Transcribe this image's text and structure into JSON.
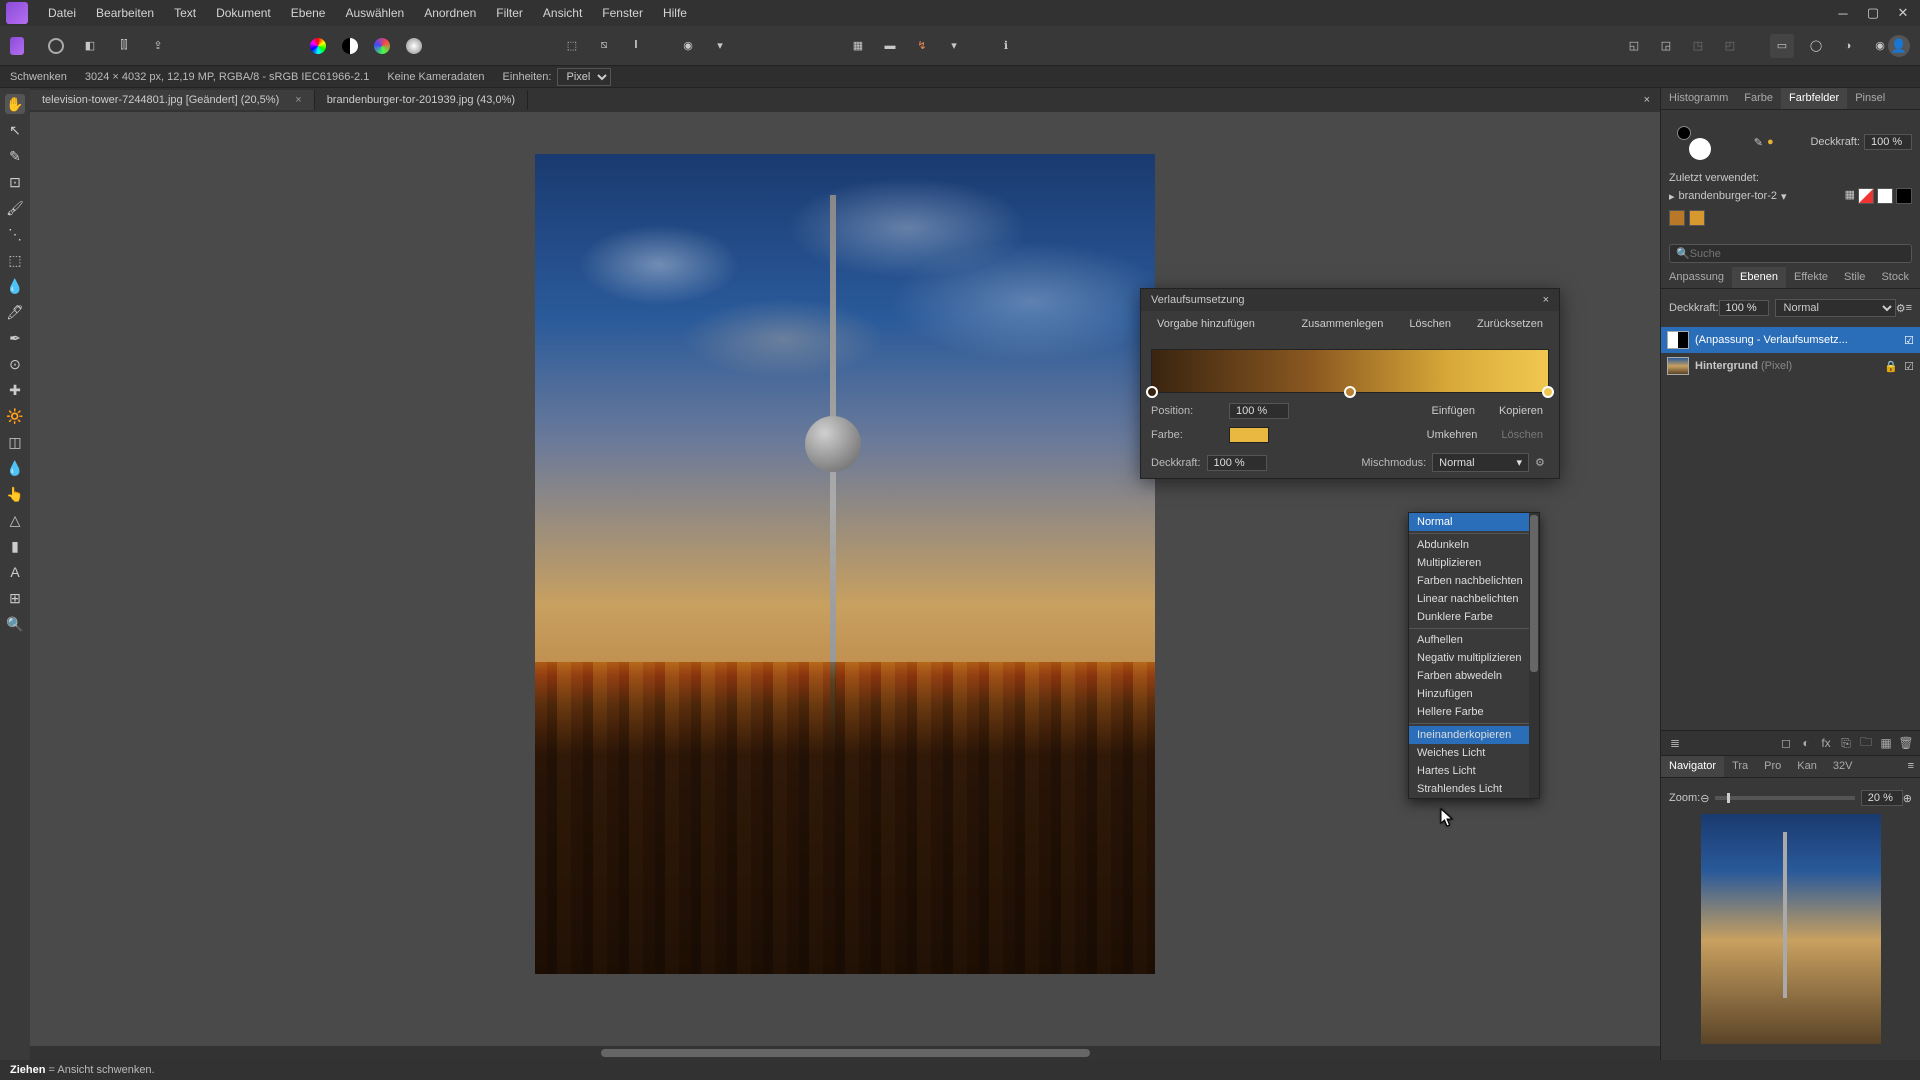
{
  "menu": [
    "Datei",
    "Bearbeiten",
    "Text",
    "Dokument",
    "Ebene",
    "Auswählen",
    "Anordnen",
    "Filter",
    "Ansicht",
    "Fenster",
    "Hilfe"
  ],
  "infobar": {
    "tool": "Schwenken",
    "dims": "3024 × 4032 px, 12,19 MP, RGBA/8 - sRGB IEC61966-2.1",
    "camera": "Keine Kameradaten",
    "units_label": "Einheiten:",
    "units_value": "Pixel"
  },
  "tabs": [
    {
      "label": "television-tower-7244801.jpg [Geändert] (20,5%)",
      "active": true
    },
    {
      "label": "brandenburger-tor-201939.jpg (43,0%)",
      "active": false
    }
  ],
  "dialog": {
    "title": "Verlaufsumsetzung",
    "add_preset": "Vorgabe hinzufügen",
    "merge": "Zusammenlegen",
    "delete": "Löschen",
    "reset": "Zurücksetzen",
    "position_label": "Position:",
    "position_value": "100 %",
    "color_label": "Farbe:",
    "insert": "Einfügen",
    "copy": "Kopieren",
    "reverse": "Umkehren",
    "delete2": "Löschen",
    "opacity_label": "Deckkraft:",
    "opacity_value": "100 %",
    "blend_label": "Mischmodus:",
    "blend_value": "Normal"
  },
  "blend_modes": {
    "groups": [
      [
        "Normal"
      ],
      [
        "Abdunkeln",
        "Multiplizieren",
        "Farben nachbelichten",
        "Linear nachbelichten",
        "Dunklere Farbe"
      ],
      [
        "Aufhellen",
        "Negativ multiplizieren",
        "Farben abwedeln",
        "Hinzufügen",
        "Hellere Farbe"
      ],
      [
        "Ineinanderkopieren",
        "Weiches Licht",
        "Hartes Licht",
        "Strahlendes Licht"
      ]
    ],
    "selected": "Normal",
    "hover": "Ineinanderkopieren"
  },
  "right": {
    "top_tabs": [
      "Histogramm",
      "Farbe",
      "Farbfelder",
      "Pinsel"
    ],
    "top_active": "Farbfelder",
    "opacity_label": "Deckkraft:",
    "opacity_value": "100 %",
    "recent_label": "Zuletzt verwendet:",
    "preset_name": "brandenburger-tor-2",
    "search_placeholder": "Suche",
    "mid_tabs": [
      "Anpassung",
      "Ebenen",
      "Effekte",
      "Stile",
      "Stock"
    ],
    "mid_active": "Ebenen",
    "layer_opacity": "100 %",
    "layer_blend": "Normal",
    "layers": [
      {
        "name": "(Anpassung - Verlaufsumsetz...",
        "type": "adj",
        "selected": true,
        "visible": true
      },
      {
        "name": "Hintergrund",
        "suffix": "(Pixel)",
        "type": "pixel",
        "selected": false,
        "locked": true,
        "visible": true
      }
    ],
    "nav_tabs": [
      "Navigator",
      "Tra",
      "Pro",
      "Kan",
      "32V"
    ],
    "nav_active": "Navigator",
    "zoom_label": "Zoom:",
    "zoom_value": "20 %"
  },
  "status": {
    "action": "Ziehen",
    "desc": "= Ansicht schwenken."
  }
}
